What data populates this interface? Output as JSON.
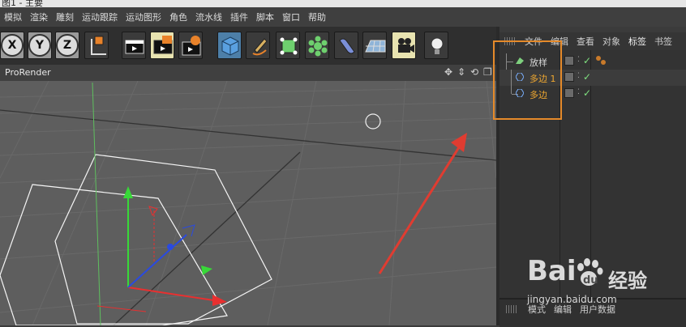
{
  "window": {
    "title": "图1 - 主要"
  },
  "menubar": {
    "items": [
      "模拟",
      "渲染",
      "雕刻",
      "运动跟踪",
      "运动图形",
      "角色",
      "流水线",
      "插件",
      "脚本",
      "窗口",
      "帮助"
    ]
  },
  "toolbar": {
    "x_label": "X",
    "y_label": "Y",
    "z_label": "Z",
    "icons": [
      "x-axis-lock-icon",
      "y-axis-lock-icon",
      "z-axis-lock-icon",
      "coordinate-system-icon",
      "render-view-icon",
      "render-picture-viewer-icon",
      "render-settings-icon",
      "cube-icon",
      "pen-spline-icon",
      "subdivision-icon",
      "cloner-icon",
      "deformer-icon",
      "floor-icon",
      "camera-icon",
      "light-icon"
    ]
  },
  "viewport": {
    "title": "ProRender",
    "nav_icons": [
      "move-view-icon",
      "zoom-view-icon",
      "rotate-view-icon",
      "maximize-view-icon"
    ],
    "label_icons": [
      "✥",
      "⇕",
      "⟲",
      "❐"
    ]
  },
  "object_manager": {
    "tabs": [
      "文件",
      "编辑",
      "查看",
      "对象",
      "标签",
      "书签"
    ],
    "active_tab": "标签",
    "objects": [
      {
        "name": "放样",
        "icon": "loft-icon",
        "color": "#d9d9d9"
      },
      {
        "name": "多边 1",
        "icon": "polygon-spline-icon",
        "color": "#f0a830"
      },
      {
        "name": "多边",
        "icon": "polygon-spline-icon",
        "color": "#f0a830"
      }
    ]
  },
  "attribute_manager": {
    "tabs": [
      "模式",
      "编辑",
      "用户数据"
    ]
  },
  "watermark": {
    "brand": "Bai",
    "brand2": "经验",
    "url": "jingyan.baidu.com"
  },
  "colors": {
    "highlight_box": "#e58a2a",
    "arrow": "#e03c31",
    "accent_active_tab": "#f0f0f0"
  }
}
